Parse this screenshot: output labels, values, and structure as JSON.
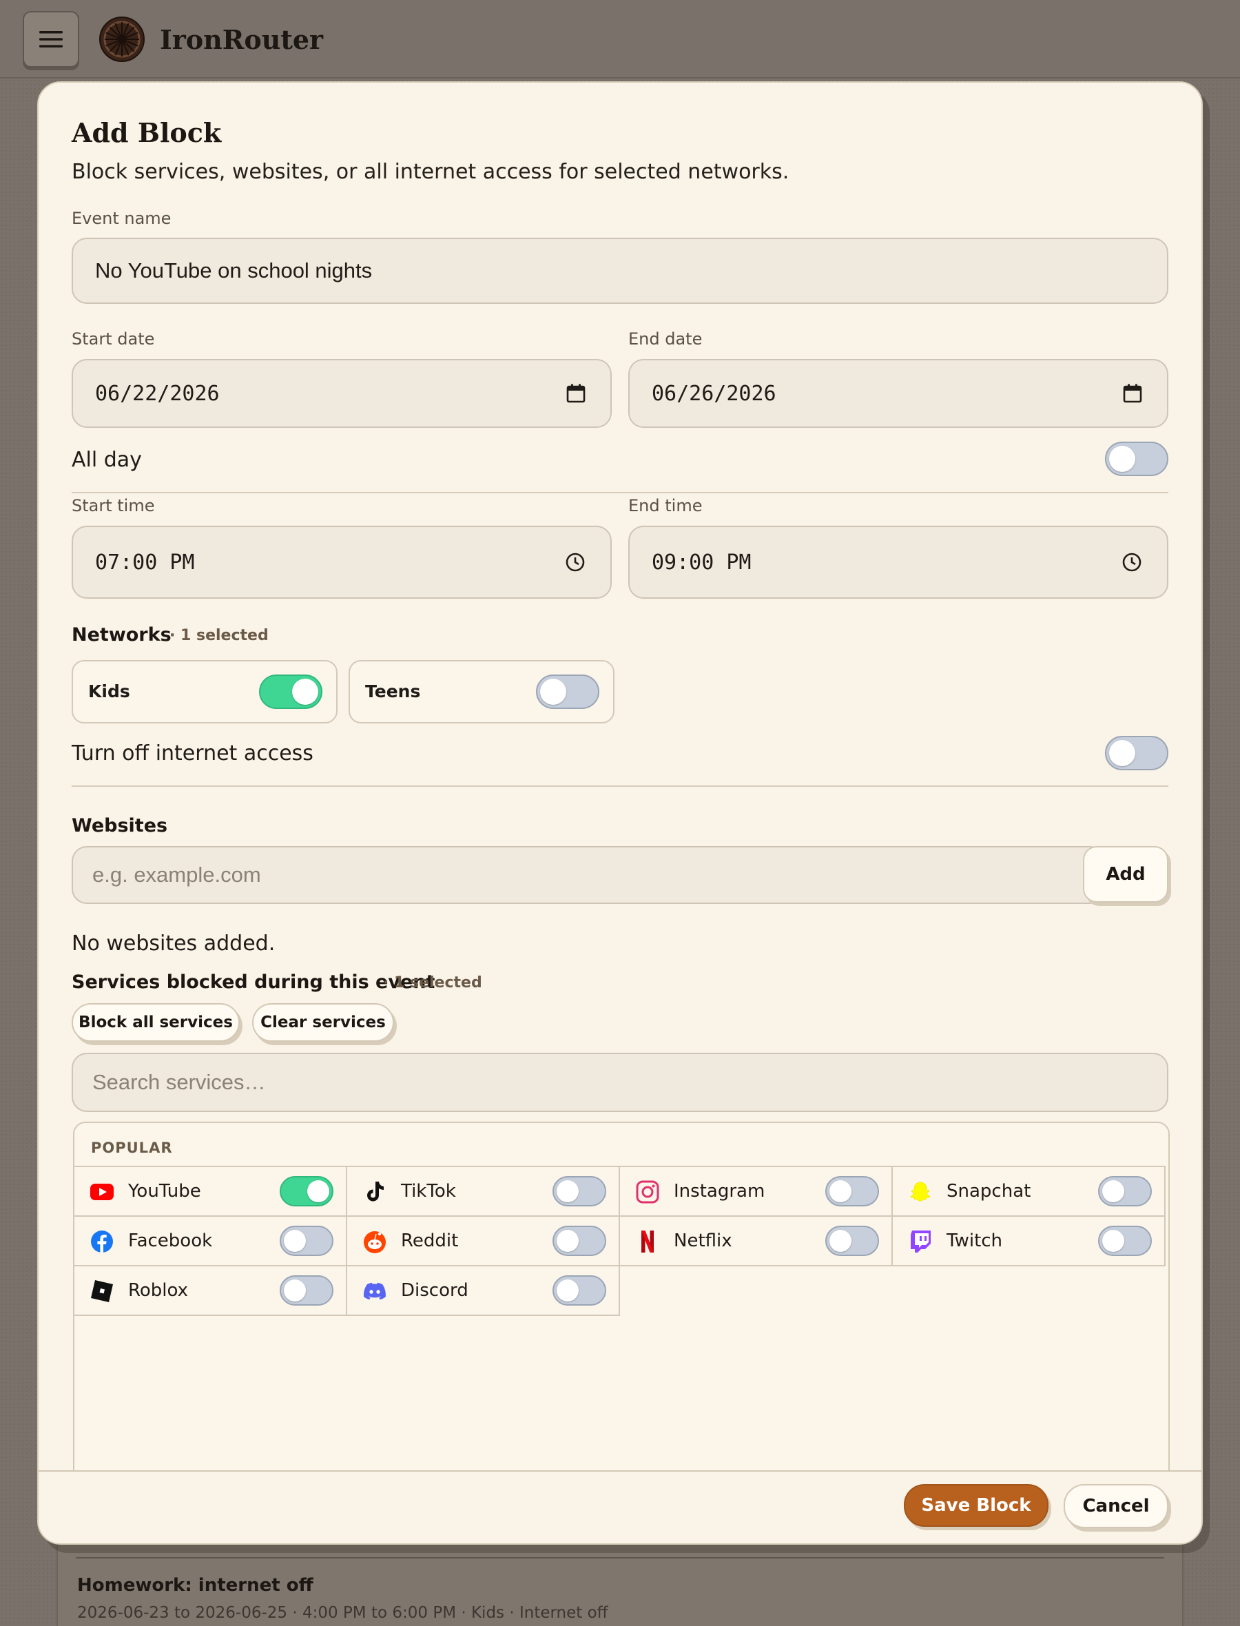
{
  "app": {
    "brand": "IronRouter"
  },
  "modal": {
    "title": "Add Block",
    "subtitle": "Block services, websites, or all internet access for selected networks.",
    "event_name": {
      "label": "Event name",
      "value": "No YouTube on school nights"
    },
    "start_date": {
      "label": "Start date",
      "value": "06/22/2026"
    },
    "end_date": {
      "label": "End date",
      "value": "06/26/2026"
    },
    "all_day": {
      "label": "All day",
      "on": false
    },
    "start_time": {
      "label": "Start time",
      "value": "07:00 PM"
    },
    "end_time": {
      "label": "End time",
      "value": "09:00 PM"
    },
    "networks": {
      "label": "Networks",
      "count": "· 1 selected",
      "items": [
        {
          "name": "Kids",
          "on": true
        },
        {
          "name": "Teens",
          "on": false
        }
      ]
    },
    "internet_off": {
      "label": "Turn off internet access",
      "on": false
    },
    "websites": {
      "label": "Websites",
      "placeholder": "e.g. example.com",
      "add_label": "Add",
      "empty_text": "No websites added."
    },
    "services": {
      "label": "Services blocked during this event",
      "count": "· 1 selected",
      "block_all_label": "Block all services",
      "clear_label": "Clear services",
      "search_placeholder": "Search services…",
      "group_label": "POPULAR",
      "items": [
        {
          "name": "YouTube",
          "icon": "youtube-icon",
          "on": true
        },
        {
          "name": "TikTok",
          "icon": "tiktok-icon",
          "on": false
        },
        {
          "name": "Instagram",
          "icon": "instagram-icon",
          "on": false
        },
        {
          "name": "Snapchat",
          "icon": "snapchat-icon",
          "on": false
        },
        {
          "name": "Facebook",
          "icon": "facebook-icon",
          "on": false
        },
        {
          "name": "Reddit",
          "icon": "reddit-icon",
          "on": false
        },
        {
          "name": "Netflix",
          "icon": "netflix-icon",
          "on": false
        },
        {
          "name": "Twitch",
          "icon": "twitch-icon",
          "on": false
        },
        {
          "name": "Roblox",
          "icon": "roblox-icon",
          "on": false
        },
        {
          "name": "Discord",
          "icon": "discord-icon",
          "on": false
        }
      ]
    },
    "footer": {
      "save_label": "Save Block",
      "cancel_label": "Cancel"
    }
  },
  "background_list": {
    "items": [
      {
        "title": "Homework: internet off",
        "meta": "2026-06-23 to 2026-06-25 · 4:00 PM to 6:00 PM · Kids · Internet off"
      }
    ]
  },
  "colors": {
    "accent": "#b8611e",
    "toggle_on": "#3fd694",
    "toggle_off": "#c7cfdc",
    "modal_bg": "#faf3e7",
    "backdrop": "#7a726a"
  }
}
